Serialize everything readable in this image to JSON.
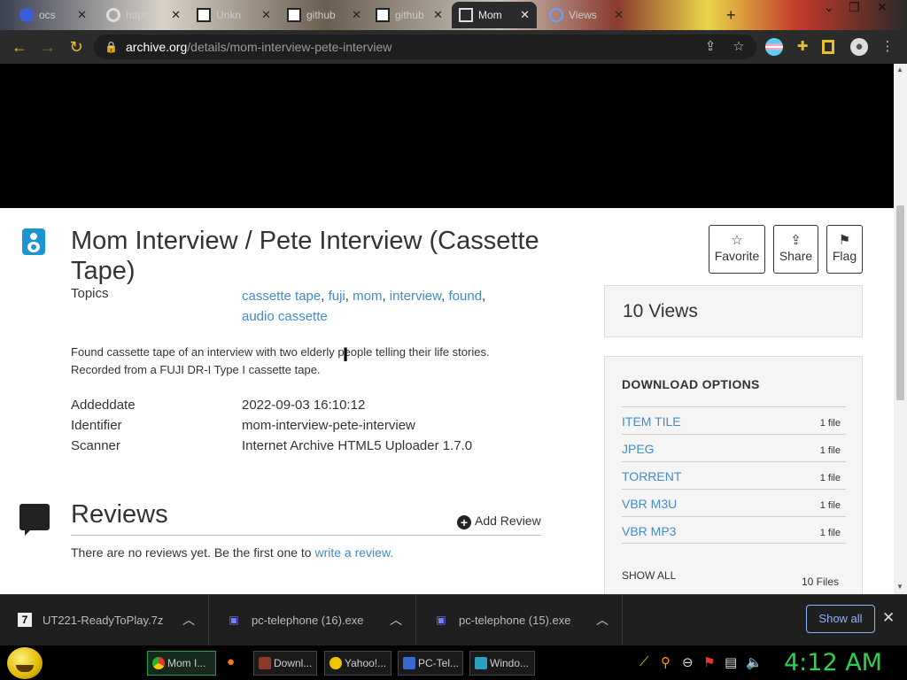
{
  "browser": {
    "tabs": [
      {
        "label": "ocs",
        "active": false
      },
      {
        "label": "https",
        "active": false
      },
      {
        "label": "Unkn",
        "active": false
      },
      {
        "label": "github",
        "active": false
      },
      {
        "label": "github",
        "active": false
      },
      {
        "label": "Mom",
        "active": true
      },
      {
        "label": "Views",
        "active": false
      }
    ],
    "url_domain": "archive.org",
    "url_path": "/details/mom-interview-pete-interview"
  },
  "item": {
    "title": "Mom Interview / Pete Interview (Cassette Tape)",
    "topics_label": "Topics",
    "topics": [
      "cassette tape",
      "fuji",
      "mom",
      "interview",
      "found",
      "audio cassette"
    ],
    "description_line1": "Found cassette tape of an interview with two elderly people telling their life stories.",
    "description_line2": "Recorded from a FUJI DR-I Type I cassette tape.",
    "meta": [
      {
        "label": "Addeddate",
        "value": "2022-09-03 16:10:12"
      },
      {
        "label": "Identifier",
        "value": "mom-interview-pete-interview"
      },
      {
        "label": "Scanner",
        "value": "Internet Archive HTML5 Uploader 1.7.0"
      }
    ]
  },
  "actions": {
    "favorite": "Favorite",
    "share": "Share",
    "flag": "Flag"
  },
  "views": "10 Views",
  "downloads": {
    "heading": "DOWNLOAD OPTIONS",
    "rows": [
      {
        "name": "ITEM TILE",
        "count": "1 file"
      },
      {
        "name": "JPEG",
        "count": "1 file"
      },
      {
        "name": "TORRENT",
        "count": "1 file"
      },
      {
        "name": "VBR M3U",
        "count": "1 file"
      },
      {
        "name": "VBR MP3",
        "count": "1 file"
      }
    ],
    "show_all": "SHOW ALL",
    "total": "10 Files"
  },
  "reviews": {
    "title": "Reviews",
    "add_label": "Add Review",
    "empty_text": "There are no reviews yet. Be the first one to ",
    "write_link": "write a review."
  },
  "download_bar": {
    "items": [
      "UT221-ReadyToPlay.7z",
      "pc-telephone (16).exe",
      "pc-telephone (15).exe"
    ],
    "show_all": "Show all"
  },
  "taskbar": {
    "tasks": [
      "Mom I...",
      "Downl...",
      "Yahoo!...",
      "PC-Tel...",
      "Windo..."
    ],
    "clock": "4:12 AM"
  },
  "colors": {
    "link": "#428bca",
    "accent_green": "#2ad14f",
    "chrome_yellow": "#e8c12a"
  }
}
